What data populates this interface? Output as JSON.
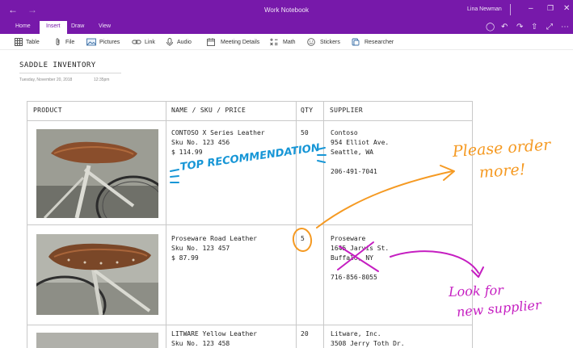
{
  "window": {
    "title": "Work Notebook",
    "user": "Lina Newman",
    "back_icon": "arrow-left-icon",
    "forward_icon": "arrow-right-icon",
    "accent_color": "#7719aa"
  },
  "tabs": [
    {
      "label": "Home"
    },
    {
      "label": "Insert"
    },
    {
      "label": "Draw"
    },
    {
      "label": "View"
    }
  ],
  "ribbon": [
    {
      "label": "Table",
      "icon": "table-icon"
    },
    {
      "label": "File",
      "icon": "paperclip-icon"
    },
    {
      "label": "Pictures",
      "icon": "picture-icon"
    },
    {
      "label": "Link",
      "icon": "link-icon"
    },
    {
      "label": "Audio",
      "icon": "microphone-icon"
    },
    {
      "label": "Meeting Details",
      "icon": "calendar-icon"
    },
    {
      "label": "Math",
      "icon": "math-icon"
    },
    {
      "label": "Stickers",
      "icon": "sticker-icon"
    },
    {
      "label": "Researcher",
      "icon": "researcher-icon"
    }
  ],
  "page": {
    "title": "SADDLE INVENTORY",
    "date": "Tuesday, November 20, 2018",
    "time": "12:35pm"
  },
  "table": {
    "headers": [
      "PRODUCT",
      "NAME / SKU / PRICE",
      "QTY",
      "SUPPLIER"
    ],
    "rows": [
      {
        "name": "CONTOSO X Series Leather",
        "sku": "Sku No. 123 456",
        "price": "$ 114.99",
        "qty": "50",
        "supplier": "Contoso",
        "address1": "954 Elliot Ave.",
        "address2": "Seattle, WA",
        "phone": "206-491-7041"
      },
      {
        "name": "Proseware Road Leather",
        "sku": "Sku No. 123 457",
        "price": "$ 87.99",
        "qty": "5",
        "supplier": "Proseware",
        "address1": "1645 Jarvis St.",
        "address2": "Buffalo, NY",
        "phone": "716-856-8055"
      },
      {
        "name": "LITWARE Yellow Leather",
        "sku": "Sku No. 123 458",
        "price": "",
        "qty": "20",
        "supplier": "Litware, Inc.",
        "address1": "3508 Jerry Toth Dr.",
        "address2": "",
        "phone": ""
      }
    ]
  },
  "ink": {
    "blue_note": "TOP RECOMMENDATION",
    "orange_note_1": "Please order",
    "orange_note_2": "more!",
    "magenta_note_1": "Look for",
    "magenta_note_2": "new supplier",
    "blue_color": "#1796d6",
    "orange_color": "#f59a23",
    "magenta_color": "#c51ec1"
  }
}
